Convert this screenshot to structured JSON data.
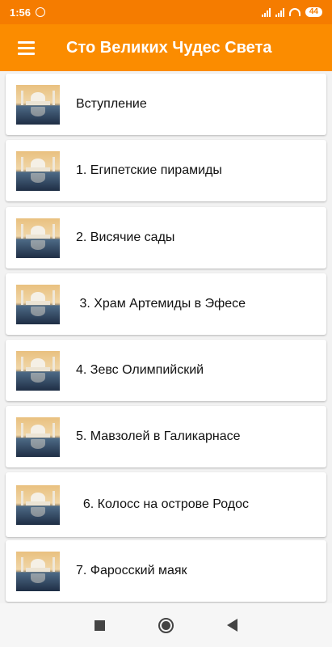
{
  "status_bar": {
    "time": "1:56",
    "battery": "44"
  },
  "app_bar": {
    "title": "Сто Великих Чудес Света"
  },
  "items": [
    {
      "label": "Вступление"
    },
    {
      "label": "1. Египетские пирамиды"
    },
    {
      "label": "2. Висячие сады"
    },
    {
      "label": " 3. Храм Артемиды в Эфесе"
    },
    {
      "label": "4. Зевс Олимпийский"
    },
    {
      "label": "5. Мавзолей в Галикарнасе"
    },
    {
      "label": "  6. Колосс на острове Родос"
    },
    {
      "label": "7. Фаросский маяк"
    }
  ],
  "colors": {
    "status_bar": "#f57c00",
    "app_bar": "#fb8c00"
  }
}
